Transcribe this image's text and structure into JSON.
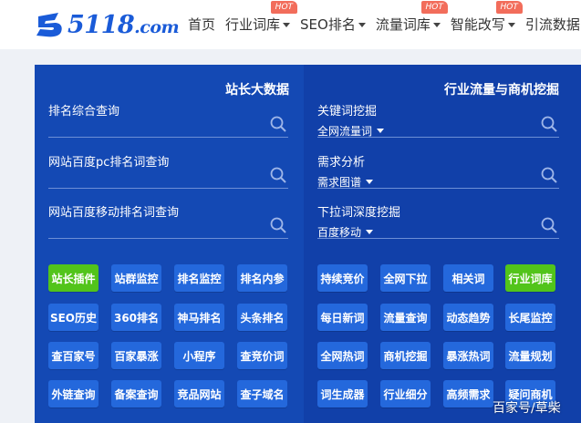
{
  "logo": {
    "text": "5118",
    "domain": ".com",
    "mark_icon": "5118-logo-mark-icon"
  },
  "nav": [
    {
      "label": "首页",
      "dropdown": false,
      "hot": ""
    },
    {
      "label": "行业词库",
      "dropdown": true,
      "hot": "HOT"
    },
    {
      "label": "SEO排名",
      "dropdown": true,
      "hot": ""
    },
    {
      "label": "流量词库",
      "dropdown": true,
      "hot": "HOT"
    },
    {
      "label": "智能改写",
      "dropdown": true,
      "hot": "HOT"
    },
    {
      "label": "引流数据",
      "dropdown": true,
      "hot": ""
    }
  ],
  "left": {
    "heading": "站长大数据",
    "fields": [
      {
        "label": "排名综合查询"
      },
      {
        "label": "网站百度pc排名词查询"
      },
      {
        "label": "网站百度移动排名词查询"
      }
    ],
    "buttons": [
      {
        "label": "站长插件",
        "active": true
      },
      {
        "label": "站群监控",
        "active": false
      },
      {
        "label": "排名监控",
        "active": false
      },
      {
        "label": "排名内参",
        "active": false
      },
      {
        "label": "SEO历史",
        "active": false
      },
      {
        "label": "360排名",
        "active": false
      },
      {
        "label": "神马排名",
        "active": false
      },
      {
        "label": "头条排名",
        "active": false
      },
      {
        "label": "查百家号",
        "active": false
      },
      {
        "label": "百家暴涨",
        "active": false
      },
      {
        "label": "小程序",
        "active": false
      },
      {
        "label": "查竞价词",
        "active": false
      },
      {
        "label": "外链查询",
        "active": false
      },
      {
        "label": "备案查询",
        "active": false
      },
      {
        "label": "竞品网站",
        "active": false
      },
      {
        "label": "查子域名",
        "active": false
      }
    ]
  },
  "right": {
    "heading": "行业流量与商机挖掘",
    "fields": [
      {
        "label": "关键词挖掘",
        "selected": "全网流量词"
      },
      {
        "label": "需求分析",
        "selected": "需求图谱"
      },
      {
        "label": "下拉词深度挖掘",
        "selected": "百度移动"
      }
    ],
    "buttons": [
      {
        "label": "持续竞价",
        "active": false
      },
      {
        "label": "全网下拉",
        "active": false
      },
      {
        "label": "相关词",
        "active": false
      },
      {
        "label": "行业词库",
        "active": true
      },
      {
        "label": "每日新词",
        "active": false
      },
      {
        "label": "流量查询",
        "active": false
      },
      {
        "label": "动态趋势",
        "active": false
      },
      {
        "label": "长尾监控",
        "active": false
      },
      {
        "label": "全网热词",
        "active": false
      },
      {
        "label": "商机挖掘",
        "active": false
      },
      {
        "label": "暴涨热词",
        "active": false
      },
      {
        "label": "流量规划",
        "active": false
      },
      {
        "label": "词生成器",
        "active": false
      },
      {
        "label": "行业细分",
        "active": false
      },
      {
        "label": "高频需求",
        "active": false
      },
      {
        "label": "疑问商机",
        "active": false
      }
    ]
  },
  "watermark": "百家号/草柴",
  "colors": {
    "brand": "#1a5bd8",
    "panel": "#1449b4",
    "button": "#2468dc",
    "active_button": "#52c41a",
    "hot_badge": "#f26d5b"
  }
}
